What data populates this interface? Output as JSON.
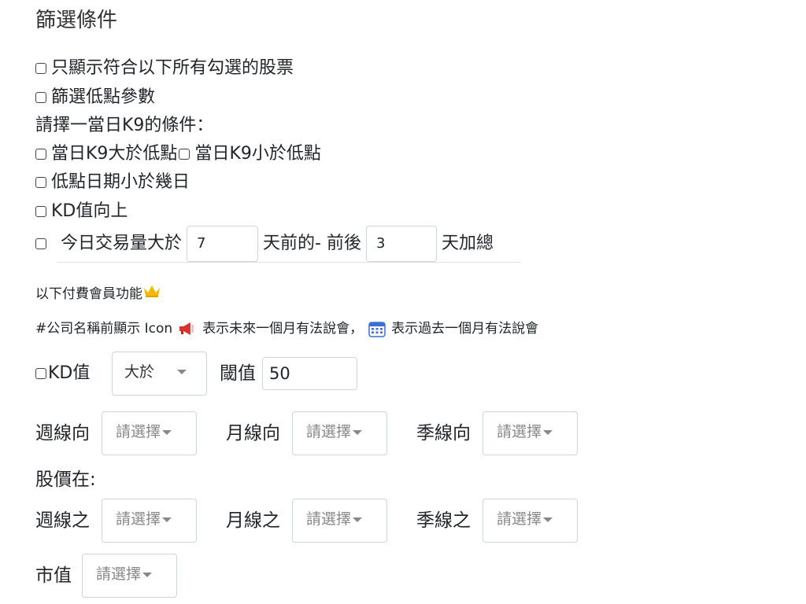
{
  "title": "篩選條件",
  "options": {
    "all_match": "只顯示符合以下所有勾選的股票",
    "low_params": "篩選低點參數",
    "k9_prompt": "請擇一當日K9的條件：",
    "k9_gt": "當日K9大於低點",
    "k9_lt": "當日K9小於低點",
    "low_date": "低點日期小於幾日",
    "kd_up": "KD值向上",
    "volume_prefix": "今日交易量大於",
    "volume_days": "7",
    "volume_mid": "天前的- 前後",
    "volume_range": "3",
    "volume_suffix": "天加總"
  },
  "paid": {
    "label": "以下付費會員功能",
    "legend_prefix": "#公司名稱前顯示 Icon",
    "legend_megaphone": "表示未來一個月有法說會，",
    "legend_calendar": "表示過去一個月有法說會",
    "kd_label": "KD值",
    "kd_operator": "大於",
    "threshold_label": "閾值",
    "threshold_value": "50"
  },
  "trend": {
    "weekly_label": "週線向",
    "monthly_label": "月線向",
    "quarterly_label": "季線向",
    "placeholder": "請選擇"
  },
  "price": {
    "heading": "股價在:",
    "weekly_label": "週線之",
    "monthly_label": "月線之",
    "quarterly_label": "季線之",
    "placeholder": "請選擇"
  },
  "market_cap": {
    "label": "市值",
    "placeholder": "請選擇"
  },
  "colors": {
    "crown": "#f5b800",
    "megaphone": "#d9342b",
    "calendar": "#3b6fd4"
  }
}
